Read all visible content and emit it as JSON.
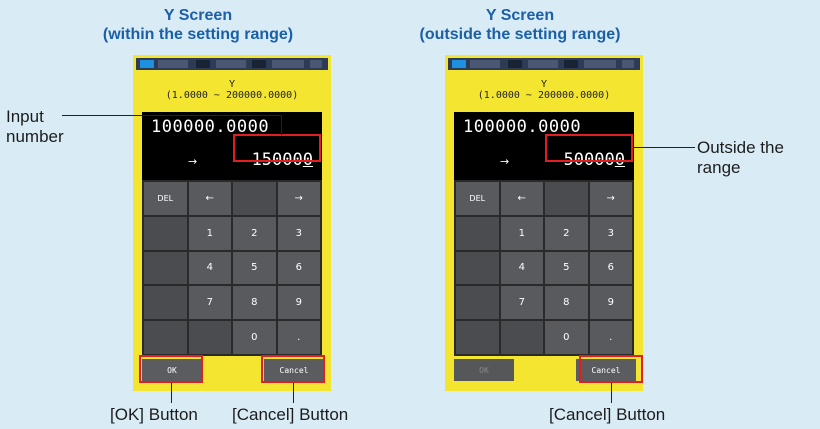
{
  "left": {
    "title_line1": "Y Screen",
    "title_line2": "(within the setting range)",
    "range_label": "Y",
    "range_text": "(1.0000 ~ 200000.0000)",
    "current_value": "100000.0000",
    "arrow": "→",
    "entry_prefix": "15000",
    "entry_cursor": "0",
    "keys": [
      "DEL",
      "←",
      "",
      "→",
      "",
      "1",
      "2",
      "3",
      "",
      "4",
      "5",
      "6",
      "",
      "7",
      "8",
      "9",
      "",
      "",
      "0",
      "."
    ],
    "ok_label": "OK",
    "cancel_label": "Cancel",
    "ok_enabled": true
  },
  "right": {
    "title_line1": "Y Screen",
    "title_line2": "(outside the setting range)",
    "range_label": "Y",
    "range_text": "(1.0000 ~ 200000.0000)",
    "current_value": "100000.0000",
    "arrow": "→",
    "entry_prefix": "50000",
    "entry_cursor": "0",
    "keys": [
      "DEL",
      "←",
      "",
      "→",
      "",
      "1",
      "2",
      "3",
      "",
      "4",
      "5",
      "6",
      "",
      "7",
      "8",
      "9",
      "",
      "",
      "0",
      "."
    ],
    "ok_label": "OK",
    "cancel_label": "Cancel",
    "ok_enabled": false
  },
  "callouts": {
    "input_number_line1": "Input",
    "input_number_line2": "number",
    "outside_line1": "Outside the",
    "outside_line2": "range",
    "ok_button": "[OK] Button",
    "cancel_button_left": "[Cancel] Button",
    "cancel_button_right": "[Cancel] Button"
  },
  "colors": {
    "background": "#d9ecf6",
    "title": "#1a5fa8",
    "device": "#f3e530",
    "highlight": "#e02020",
    "key": "#585a5d"
  }
}
